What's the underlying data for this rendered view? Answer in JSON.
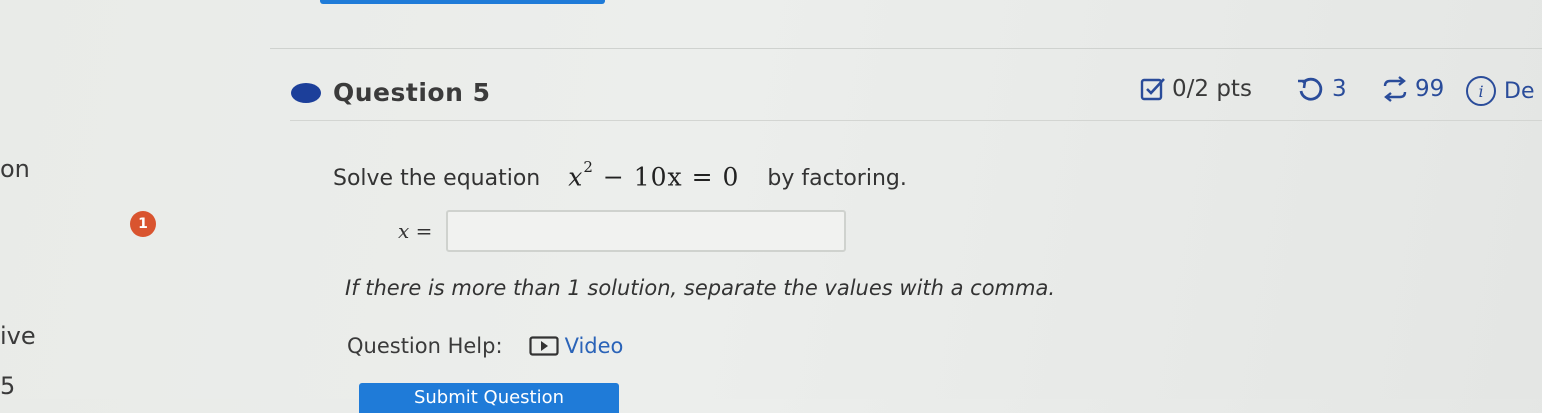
{
  "sidebar": {
    "fragment_top": "on",
    "fragment_mid": "ive",
    "fragment_bottom": "5",
    "step_badge": "1"
  },
  "question": {
    "title": "Question 5",
    "points": "0/2 pts",
    "retries": "3",
    "attempts": "99",
    "details_label": "De"
  },
  "problem": {
    "prompt_prefix": "Solve the equation",
    "equation_var": "x",
    "equation_exp": "2",
    "equation_rest": " − 10x = 0",
    "prompt_suffix": "by factoring.",
    "answer_var": "x",
    "answer_eq": "=",
    "answer_value": "",
    "hint": "If there is more than 1 solution, separate the values with a comma."
  },
  "help": {
    "label": "Question Help:",
    "video_label": "Video"
  },
  "submit": {
    "label": "Submit Question"
  },
  "colors": {
    "accent": "#1f7bd8",
    "question_dot": "#1c3f9a",
    "meta_blue": "#2a4c9a",
    "badge": "#d9542f",
    "link": "#2a63b8"
  },
  "icons": {
    "points": "checkbox-edit-icon",
    "retries": "retry-icon",
    "attempts": "sync-icon",
    "details": "info-icon",
    "video": "video-play-icon"
  }
}
